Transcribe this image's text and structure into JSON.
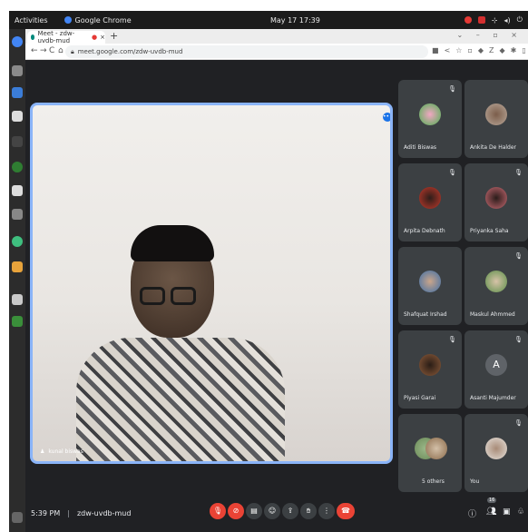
{
  "os": {
    "activities": "Activities",
    "app_name": "Google Chrome",
    "clock": "May 17  17:39"
  },
  "browser": {
    "tab_title": "Meet - zdw-uvdb-mud",
    "url": "meet.google.com/zdw-uvdb-mud"
  },
  "meet": {
    "main_participant": "kunal biswas",
    "participants": [
      {
        "name": "Aditi Biswas",
        "avatar_color": "#c94f7c"
      },
      {
        "name": "Ankita De Halder",
        "avatar_color": "#b9a89a"
      },
      {
        "name": "Arpita Debnath",
        "avatar_color": "#c0392b"
      },
      {
        "name": "Priyanka Saha",
        "avatar_color": "#c66a72"
      },
      {
        "name": "Shafquat Irshad",
        "avatar_color": "#3f6fa7"
      },
      {
        "name": "Maskul Ahmmed",
        "avatar_color": "#5c8f4a"
      },
      {
        "name": "Piyasi Garai",
        "avatar_color": "#8a5a3a"
      },
      {
        "name": "Asanti Majumder",
        "avatar_letter": "A"
      },
      {
        "name": "5 others",
        "avatar_color": "#6b8a58"
      },
      {
        "name": "You",
        "avatar_color": "#e6e1db"
      }
    ],
    "time": "5:39 PM",
    "meeting_code": "zdw-uvdb-mud",
    "badge_count": "16"
  }
}
